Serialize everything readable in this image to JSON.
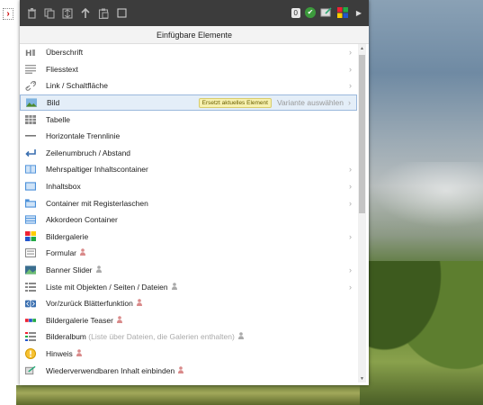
{
  "header": {
    "title": "Einfügbare Elemente"
  },
  "toolbar": {
    "count": "0",
    "icons": [
      "trash-icon",
      "copy-icon",
      "arrange-icon",
      "arrow-up-icon",
      "clipboard-icon",
      "checkbox-icon"
    ],
    "right_icons": [
      "ok-icon",
      "edit-icon",
      "colors-icon",
      "arrow-right-icon"
    ]
  },
  "items": [
    {
      "label": "Überschrift",
      "icon": "heading-icon",
      "has_submenu": true
    },
    {
      "label": "Fliesstext",
      "icon": "text-icon",
      "has_submenu": true
    },
    {
      "label": "Link / Schaltfläche",
      "icon": "link-icon",
      "has_submenu": true
    },
    {
      "label": "Bild",
      "icon": "image-icon",
      "has_submenu": true,
      "selected": true,
      "badge": "Ersetzt aktuelles Element",
      "variant": "Variante auswählen"
    },
    {
      "label": "Tabelle",
      "icon": "table-icon",
      "has_submenu": false
    },
    {
      "label": "Horizontale Trennlinie",
      "icon": "hr-icon",
      "has_submenu": false
    },
    {
      "label": "Zeilenumbruch / Abstand",
      "icon": "linebreak-icon",
      "has_submenu": false
    },
    {
      "label": "Mehrspaltiger Inhaltscontainer",
      "icon": "columns-icon",
      "has_submenu": true
    },
    {
      "label": "Inhaltsbox",
      "icon": "box-icon",
      "has_submenu": true
    },
    {
      "label": "Container mit Registerlaschen",
      "icon": "tabs-icon",
      "has_submenu": true
    },
    {
      "label": "Akkordeon Container",
      "icon": "accordion-icon",
      "has_submenu": false
    },
    {
      "label": "Bildergalerie",
      "icon": "gallery-icon",
      "has_submenu": true
    },
    {
      "label": "Formular",
      "icon": "form-icon",
      "has_submenu": false,
      "person": true
    },
    {
      "label": "Banner Slider",
      "icon": "slider-icon",
      "has_submenu": true,
      "person_grey": true
    },
    {
      "label": "Liste mit Objekten / Seiten / Dateien",
      "icon": "list-icon",
      "has_submenu": true,
      "person_grey": true
    },
    {
      "label": "Vor/zurück Blätterfunktion",
      "icon": "paging-icon",
      "has_submenu": false,
      "person": true
    },
    {
      "label": "Bildergalerie Teaser",
      "icon": "teaser-icon",
      "has_submenu": false,
      "person": true
    },
    {
      "label": "Bilderalbum",
      "muted_suffix": "(Liste über Dateien, die Galerien enthalten)",
      "icon": "album-icon",
      "has_submenu": false,
      "person_grey": true
    },
    {
      "label": "Hinweis",
      "icon": "hint-icon",
      "has_submenu": false,
      "person": true
    },
    {
      "label": "Wiederverwendbaren Inhalt einbinden",
      "icon": "reuse-icon",
      "has_submenu": false,
      "person": true
    }
  ]
}
